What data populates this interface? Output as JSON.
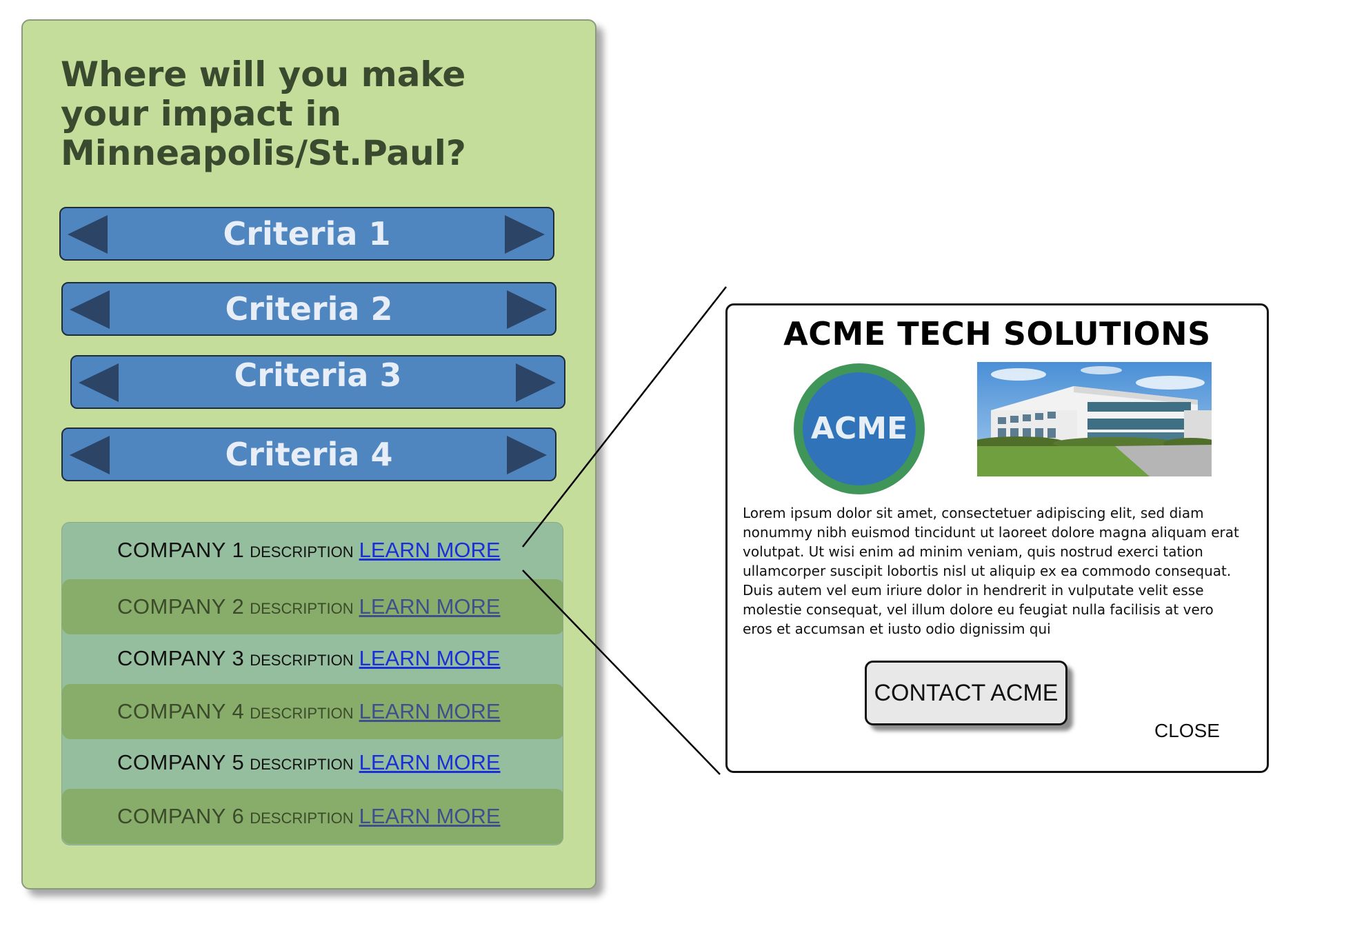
{
  "panel": {
    "title": "Where will you make\nyour impact in\nMinneapolis/St.Paul?"
  },
  "criteria": [
    {
      "label": "Criteria 1"
    },
    {
      "label": "Criteria 2"
    },
    {
      "label": "Criteria 3"
    },
    {
      "label": "Criteria 4"
    }
  ],
  "companies": [
    {
      "name": "COMPANY 1",
      "description": "DESCRIPTION",
      "link": "LEARN MORE"
    },
    {
      "name": "COMPANY 2",
      "description": "DESCRIPTION",
      "link": "LEARN MORE"
    },
    {
      "name": "COMPANY 3",
      "description": "DESCRIPTION",
      "link": "LEARN MORE"
    },
    {
      "name": "COMPANY 4",
      "description": "DESCRIPTION",
      "link": "LEARN MORE"
    },
    {
      "name": "COMPANY 5",
      "description": "DESCRIPTION",
      "link": "LEARN MORE"
    },
    {
      "name": "COMPANY 6",
      "description": "DESCRIPTION",
      "link": "LEARN MORE"
    }
  ],
  "popup": {
    "title": "ACME TECH SOLUTIONS",
    "logo_text": "ACME",
    "body": "Lorem ipsum dolor sit amet, consectetuer adipiscing elit, sed diam nonummy nibh euismod tincidunt ut laoreet dolore magna aliquam erat volutpat. Ut wisi enim ad minim veniam, quis nostrud exerci tation ullamcorper suscipit lobortis nisl ut aliquip ex ea commodo consequat. Duis autem vel eum iriure dolor in hendrerit in vulputate velit esse molestie consequat, vel illum dolore eu feugiat nulla facilisis at vero eros et accumsan et iusto odio dignissim qui",
    "contact_label": "CONTACT ACME",
    "close_label": "CLOSE"
  },
  "colors": {
    "panel_bg": "#c4dd9b",
    "criteria_bg": "#5086c0",
    "arrow": "#2c4466",
    "list_bg": "#95be9e",
    "list_alt_bg": "#88ad6a",
    "link": "#1a2fd8",
    "logo_fill": "#3173b9",
    "logo_ring": "#3f9658"
  }
}
